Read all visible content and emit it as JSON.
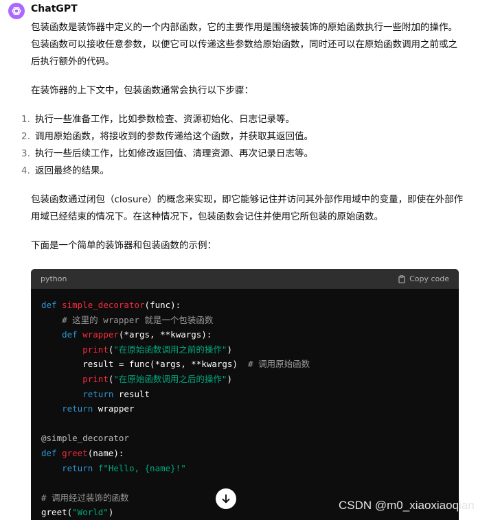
{
  "author": "ChatGPT",
  "paragraphs": [
    "包装函数是装饰器中定义的一个内部函数，它的主要作用是围绕被装饰的原始函数执行一些附加的操作。包装函数可以接收任意参数，以便它可以传递这些参数给原始函数，同时还可以在原始函数调用之前或之后执行额外的代码。",
    "在装饰器的上下文中，包装函数通常会执行以下步骤："
  ],
  "steps": [
    {
      "num": "1.",
      "text": "执行一些准备工作，比如参数检查、资源初始化、日志记录等。"
    },
    {
      "num": "2.",
      "text": "调用原始函数，将接收到的参数传递给这个函数，并获取其返回值。"
    },
    {
      "num": "3.",
      "text": "执行一些后续工作，比如修改返回值、清理资源、再次记录日志等。"
    },
    {
      "num": "4.",
      "text": "返回最终的结果。"
    }
  ],
  "paragraph_closure": "包装函数通过闭包（closure）的概念来实现，即它能够记住并访问其外部作用域中的变量，即使在外部作用域已经结束的情况下。在这种情况下，包装函数会记住并使用它所包装的原始函数。",
  "paragraph_example": "下面是一个简单的装饰器和包装函数的示例：",
  "code": {
    "language": "python",
    "copy_label": "Copy code",
    "lines": [
      [
        [
          "k",
          "def "
        ],
        [
          "f",
          "simple_decorator"
        ],
        [
          "",
          "(func):"
        ]
      ],
      [
        [
          "",
          "    "
        ],
        [
          "c",
          "# 这里的 wrapper 就是一个包装函数"
        ]
      ],
      [
        [
          "",
          "    "
        ],
        [
          "k",
          "def "
        ],
        [
          "f",
          "wrapper"
        ],
        [
          "",
          "(*args, **kwargs):"
        ]
      ],
      [
        [
          "",
          "        "
        ],
        [
          "f",
          "print"
        ],
        [
          "",
          "("
        ],
        [
          "s",
          "\"在原始函数调用之前的操作\""
        ],
        [
          "",
          ")"
        ]
      ],
      [
        [
          "",
          "        result = func(*args, **kwargs)  "
        ],
        [
          "c",
          "# 调用原始函数"
        ]
      ],
      [
        [
          "",
          "        "
        ],
        [
          "f",
          "print"
        ],
        [
          "",
          "("
        ],
        [
          "s",
          "\"在原始函数调用之后的操作\""
        ],
        [
          "",
          ")"
        ]
      ],
      [
        [
          "",
          "        "
        ],
        [
          "k",
          "return"
        ],
        [
          "",
          " result"
        ]
      ],
      [
        [
          "",
          "    "
        ],
        [
          "k",
          "return"
        ],
        [
          "",
          " wrapper"
        ]
      ],
      [
        [
          "",
          ""
        ]
      ],
      [
        [
          "d",
          "@simple_decorator"
        ]
      ],
      [
        [
          "k",
          "def "
        ],
        [
          "f",
          "greet"
        ],
        [
          "",
          "(name):"
        ]
      ],
      [
        [
          "",
          "    "
        ],
        [
          "k",
          "return"
        ],
        [
          "",
          " "
        ],
        [
          "s",
          "f\"Hello, {name}!\""
        ]
      ],
      [
        [
          "",
          ""
        ]
      ],
      [
        [
          "c",
          "# 调用经过装饰的函数"
        ]
      ],
      [
        [
          "",
          "greet("
        ],
        [
          "s",
          "\"World\""
        ],
        [
          "",
          ")"
        ]
      ]
    ]
  },
  "watermark": "CSDN @m0_xiaoxiaoqian",
  "colors": {
    "avatar": "#ab68ff",
    "keyword": "#2e95d3",
    "function": "#f22c3d",
    "string": "#00a67d",
    "comment": "#9a9a9a"
  },
  "icons": {
    "avatar": "openai-logo-icon",
    "copy": "clipboard-icon",
    "scroll": "arrow-down-icon"
  }
}
